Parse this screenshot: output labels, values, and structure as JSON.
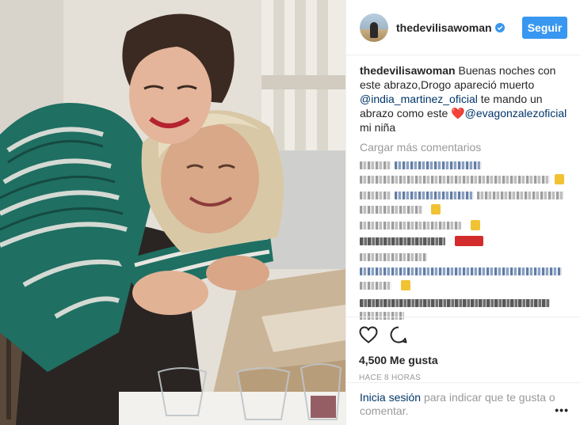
{
  "header": {
    "username": "thedevilisawoman",
    "follow_label": "Seguir"
  },
  "caption": {
    "username": "thedevilisawoman",
    "text_1": "Buenas noches con este abrazo,Drogo apareció muerto",
    "mention_1": "@india_martinez_oficial",
    "text_2": "te mando un abrazo como este",
    "heart": "❤️",
    "mention_2": "@evagonzalezoficial",
    "text_3": "mi niña"
  },
  "load_more_label": "Cargar más comentarios",
  "actions": {
    "likes": "4,500 Me gusta",
    "timestamp": "HACE 8 HORAS"
  },
  "footer": {
    "login_label": "Inicia sesión",
    "text": "para indicar que te gusta o comentar.",
    "more_label": "•••"
  },
  "colors": {
    "accent": "#3897f0",
    "link": "#003569",
    "muted": "#999999"
  }
}
